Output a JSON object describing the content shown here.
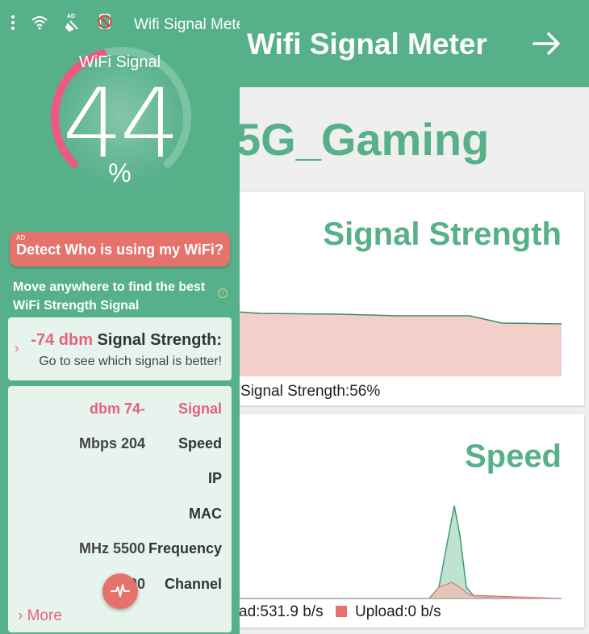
{
  "right_app": {
    "title": "Wifi Signal Meter",
    "ssid": "5G_Gaming",
    "signal_card": {
      "title": "Signal Strength",
      "legend": "Signal Strength:56%"
    },
    "speed_card": {
      "title": "Speed",
      "legend_download": "ad:531.9 b/s",
      "legend_upload": "Upload:0 b/s"
    }
  },
  "left_panel": {
    "status_title": "Wifi Signal Meter",
    "gauge": {
      "label": "WiFi Signal",
      "value": "44",
      "unit": "%",
      "percent": 44
    },
    "ad_button": {
      "tag": "AD",
      "label": "Detect Who is using my WiFi?"
    },
    "hint": "Move anywhere to find the best WiFi Strength Signal",
    "signal_card": {
      "dbm": "-74 dbm",
      "label": "Signal Strength:",
      "subtext": "Go to see which signal is better!"
    },
    "info_rows": [
      {
        "key": "Signal",
        "value": "dbm 74-"
      },
      {
        "key": "Speed",
        "value": "Mbps 204"
      },
      {
        "key": "IP",
        "value": ""
      },
      {
        "key": "MAC",
        "value": ""
      },
      {
        "key": "Frequency",
        "value": "MHz 5500"
      },
      {
        "key": "Channel",
        "value": "00"
      }
    ],
    "more_label": "More"
  },
  "colors": {
    "primary": "#56b08a",
    "accent": "#e5736c",
    "highlight": "#e5627a",
    "card_bg": "#e7f4ee"
  },
  "icons": [
    "more-vert-icon",
    "wifi-icon",
    "ad-broom-icon",
    "no-ads-icon",
    "arrow-right-icon",
    "chevron-right-icon",
    "pulse-icon"
  ]
}
